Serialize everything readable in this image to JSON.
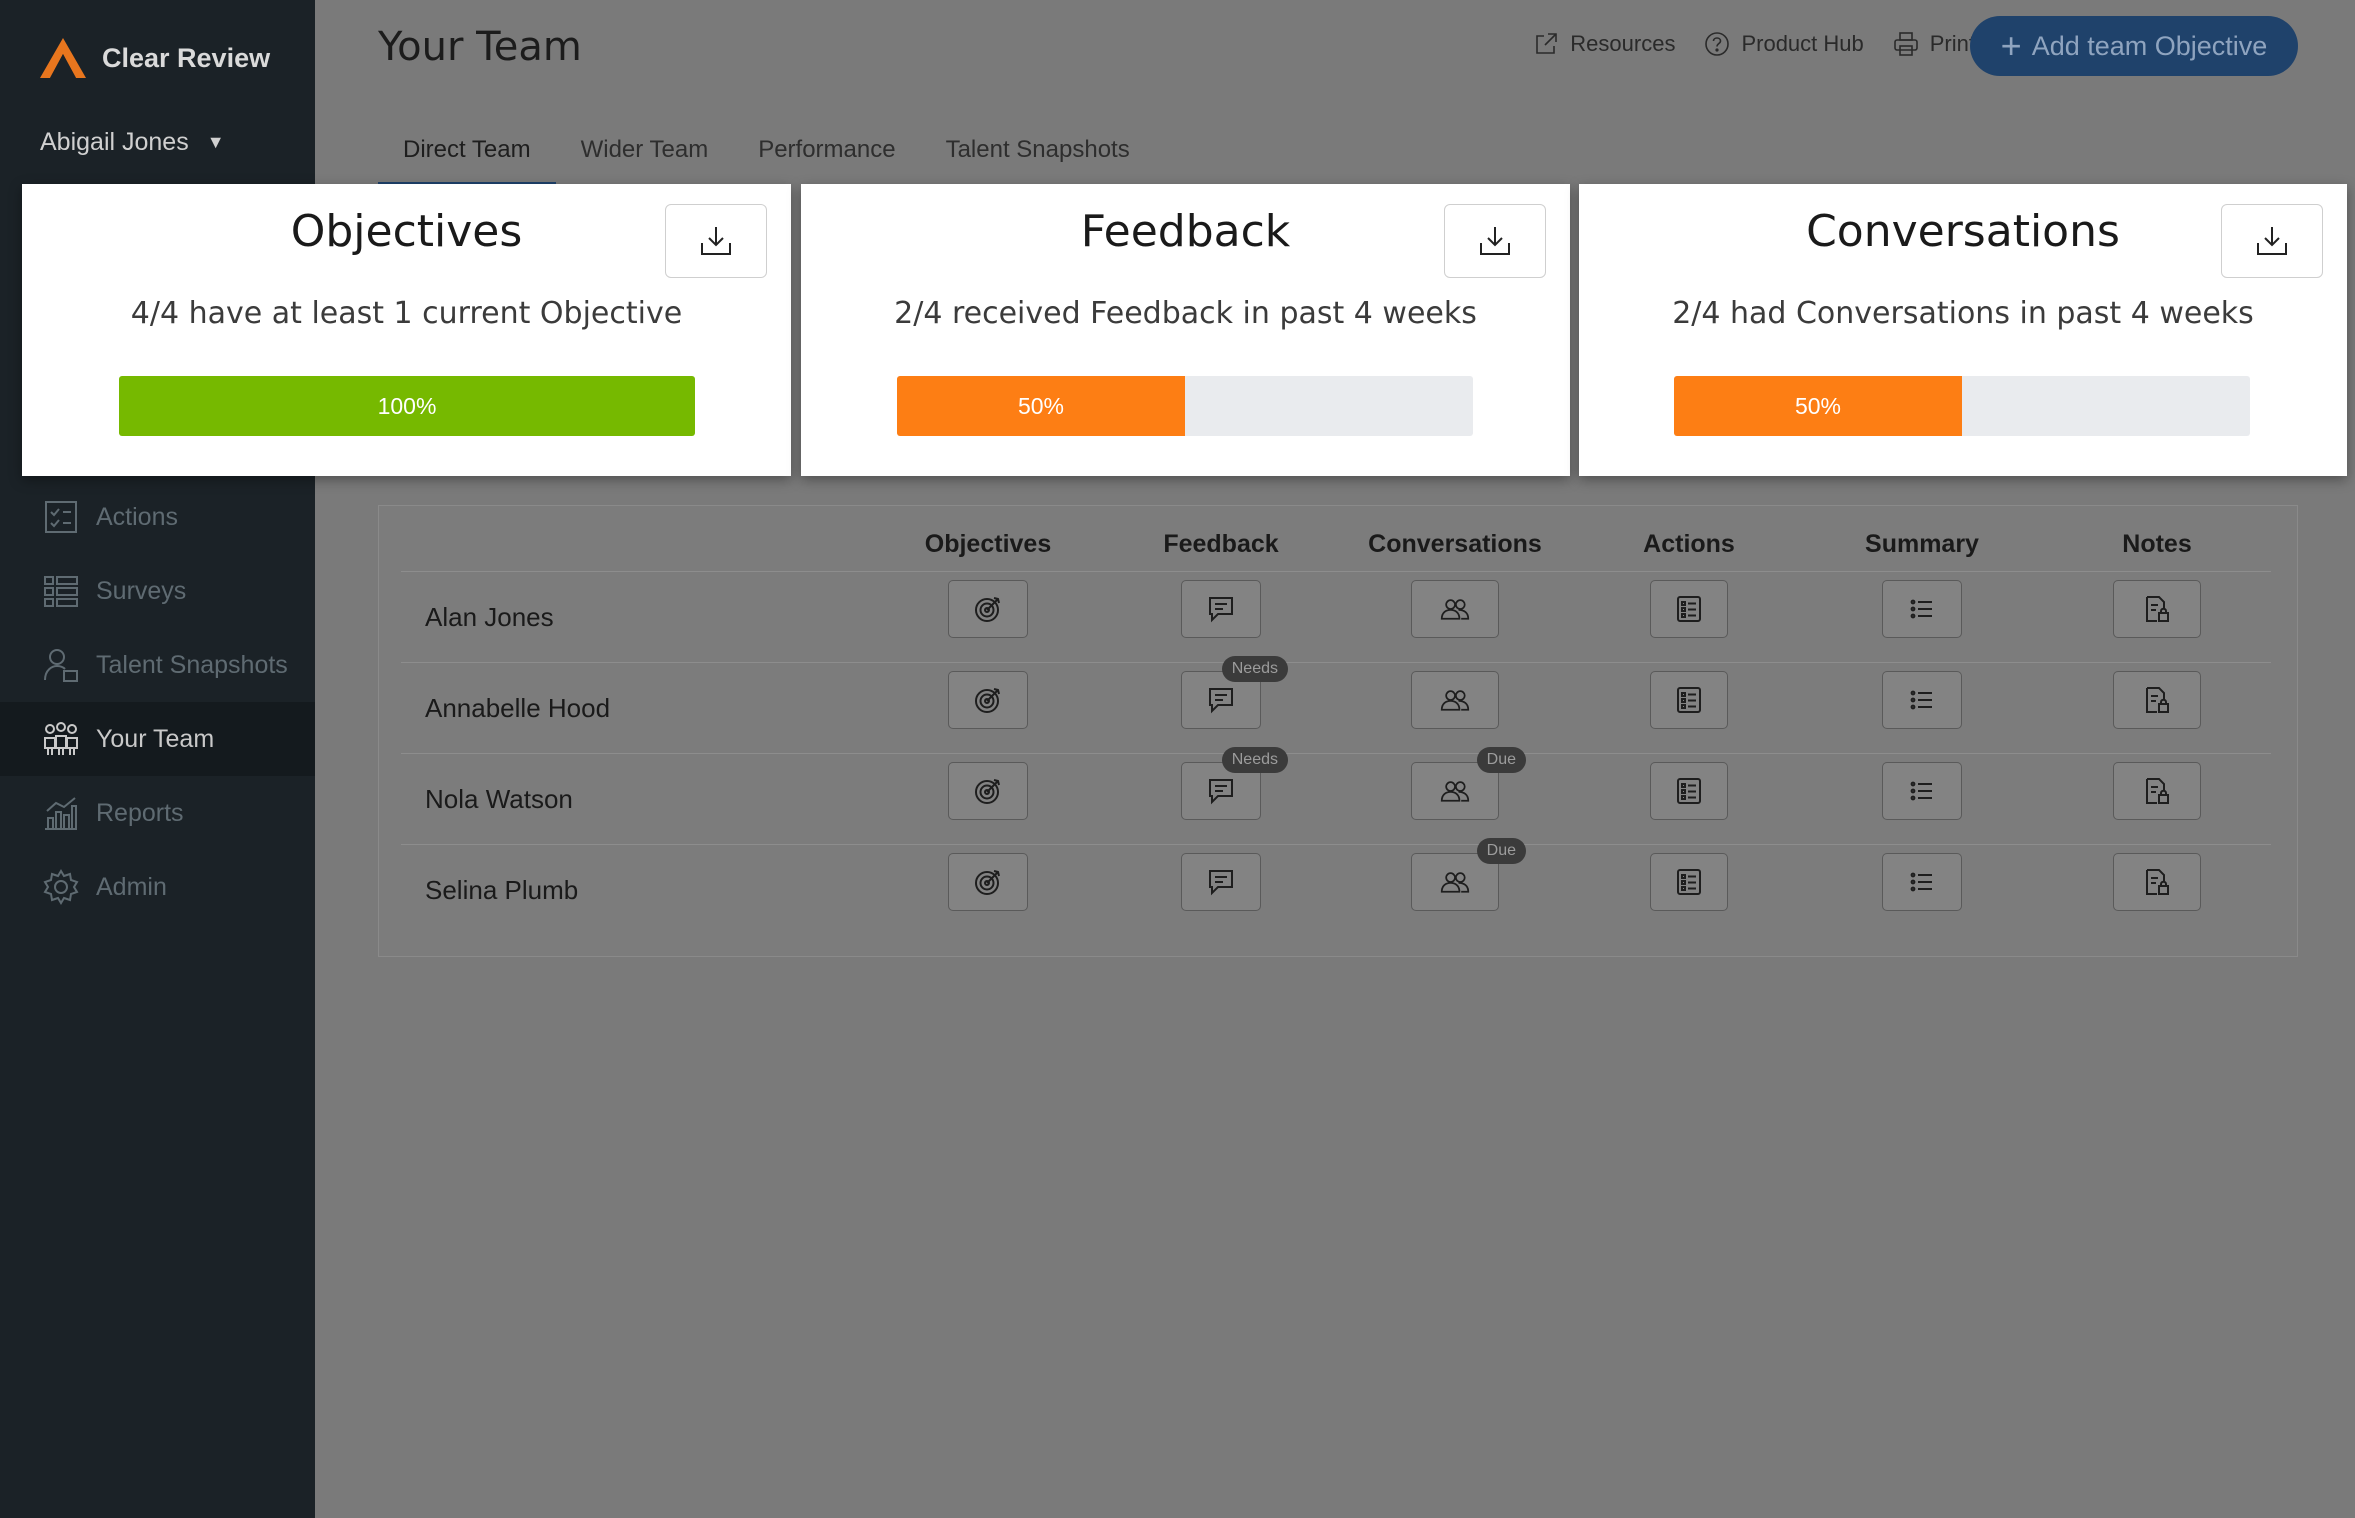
{
  "app": {
    "name": "Clear Review",
    "brand_color": "#e8761e"
  },
  "user": {
    "name": "Abigail Jones"
  },
  "sidebar": {
    "items": [
      {
        "label": "Actions",
        "icon": "checklist-icon",
        "active": false
      },
      {
        "label": "Surveys",
        "icon": "survey-icon",
        "active": false
      },
      {
        "label": "Talent Snapshots",
        "icon": "talent-snapshot-icon",
        "active": false
      },
      {
        "label": "Your Team",
        "icon": "team-icon",
        "active": true
      },
      {
        "label": "Reports",
        "icon": "reports-icon",
        "active": false
      },
      {
        "label": "Admin",
        "icon": "gear-icon",
        "active": false
      }
    ]
  },
  "header": {
    "title": "Your Team",
    "links": {
      "resources": "Resources",
      "product_hub": "Product Hub",
      "print": "Print"
    },
    "add_button": "Add team Objective"
  },
  "tabs": [
    "Direct Team",
    "Wider Team",
    "Performance",
    "Talent Snapshots"
  ],
  "cards": [
    {
      "title": "Objectives",
      "subtitle": "4/4 have at least 1 current Objective",
      "progress": 100,
      "progress_label": "100%",
      "color": "#76b900"
    },
    {
      "title": "Feedback",
      "subtitle": "2/4 received Feedback in past 4 weeks",
      "progress": 50,
      "progress_label": "50%",
      "color": "#fd7e14"
    },
    {
      "title": "Conversations",
      "subtitle": "2/4 had Conversations in past 4 weeks",
      "progress": 50,
      "progress_label": "50%",
      "color": "#fd7e14"
    }
  ],
  "table": {
    "columns": [
      "Objectives",
      "Feedback",
      "Conversations",
      "Actions",
      "Summary",
      "Notes"
    ],
    "rows": [
      {
        "name": "Alan Jones",
        "feedback_badge": "",
        "conversations_badge": ""
      },
      {
        "name": "Annabelle Hood",
        "feedback_badge": "Needs",
        "conversations_badge": ""
      },
      {
        "name": "Nola Watson",
        "feedback_badge": "Needs",
        "conversations_badge": "Due"
      },
      {
        "name": "Selina Plumb",
        "feedback_badge": "",
        "conversations_badge": "Due"
      }
    ]
  }
}
